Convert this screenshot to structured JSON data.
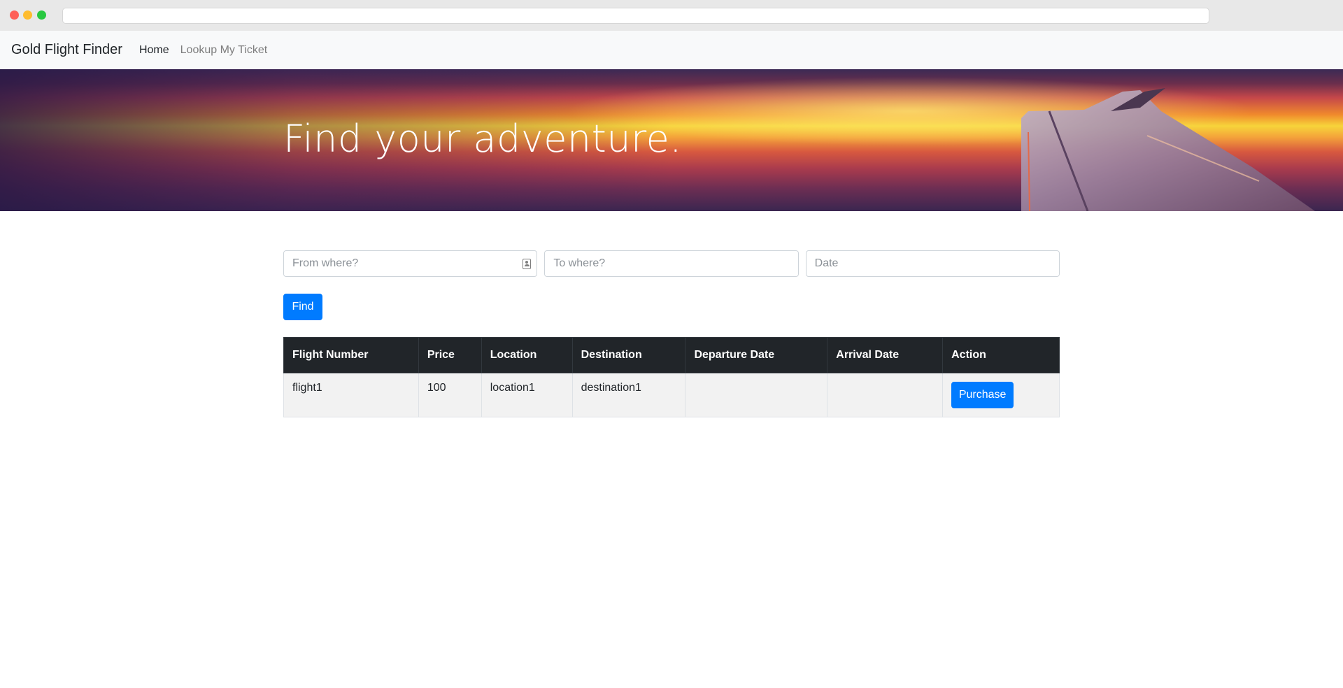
{
  "navbar": {
    "brand": "Gold Flight Finder",
    "links": [
      {
        "label": "Home",
        "active": true
      },
      {
        "label": "Lookup My Ticket",
        "active": false
      }
    ]
  },
  "hero": {
    "title": "Find your adventure."
  },
  "search": {
    "from_placeholder": "From where?",
    "to_placeholder": "To where?",
    "date_placeholder": "Date",
    "from_value": "",
    "to_value": "",
    "date_value": "",
    "find_label": "Find",
    "from_icon": "contact-card-icon"
  },
  "table": {
    "headers": [
      "Flight Number",
      "Price",
      "Location",
      "Destination",
      "Departure Date",
      "Arrival Date",
      "Action"
    ],
    "rows": [
      {
        "flight_number": "flight1",
        "price": "100",
        "location": "location1",
        "destination": "destination1",
        "departure_date": "",
        "arrival_date": "",
        "action_label": "Purchase"
      }
    ]
  },
  "colors": {
    "primary": "#007bff",
    "table_header_bg": "#212529",
    "navbar_bg": "#f8f9fa"
  }
}
